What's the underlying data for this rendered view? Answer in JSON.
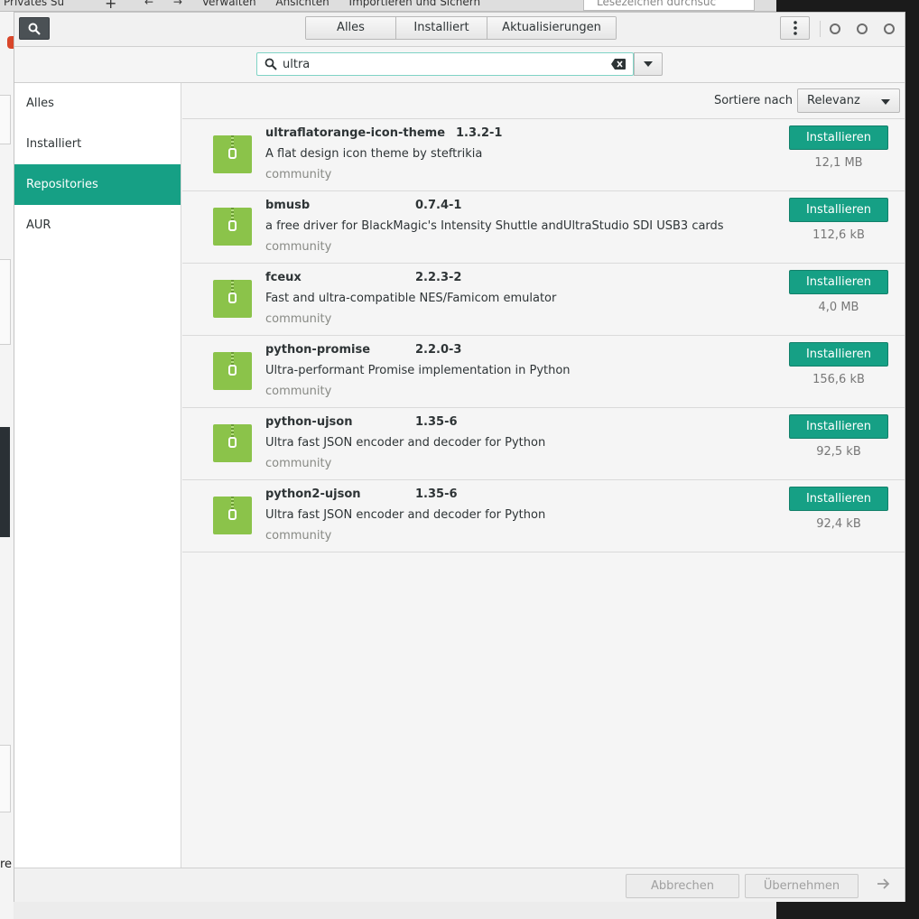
{
  "background": {
    "tab_title": "Privates Su",
    "toolbar": [
      "Verwalten",
      "Ansichten",
      "Importieren und Sichern"
    ],
    "search_placeholder": "Lesezeichen durchsuc",
    "fragment_text": "re"
  },
  "header": {
    "view_tabs": [
      "Alles",
      "Installiert",
      "Aktualisierungen"
    ]
  },
  "search": {
    "query": "ultra"
  },
  "sidebar": {
    "items": [
      {
        "label": "Alles"
      },
      {
        "label": "Installiert"
      },
      {
        "label": "Repositories"
      },
      {
        "label": "AUR"
      }
    ]
  },
  "sort": {
    "label": "Sortiere nach",
    "value": "Relevanz"
  },
  "packages": [
    {
      "name": "ultraflatorange-icon-theme",
      "version": "1.3.2-1",
      "description": "A flat design icon theme by steftrikia",
      "repo": "community",
      "size": "12,1  MB",
      "action": "Installieren"
    },
    {
      "name": "bmusb",
      "version": "0.7.4-1",
      "description": "a free driver for BlackMagic's Intensity Shuttle andUltraStudio SDI USB3 cards",
      "repo": "community",
      "size": "112,6  kB",
      "action": "Installieren"
    },
    {
      "name": "fceux",
      "version": "2.2.3-2",
      "description": "Fast and ultra-compatible NES/Famicom emulator",
      "repo": "community",
      "size": "4,0  MB",
      "action": "Installieren"
    },
    {
      "name": "python-promise",
      "version": "2.2.0-3",
      "description": "Ultra-performant Promise implementation in Python",
      "repo": "community",
      "size": "156,6  kB",
      "action": "Installieren"
    },
    {
      "name": "python-ujson",
      "version": "1.35-6",
      "description": "Ultra fast JSON encoder and decoder for Python",
      "repo": "community",
      "size": "92,5  kB",
      "action": "Installieren"
    },
    {
      "name": "python2-ujson",
      "version": "1.35-6",
      "description": "Ultra fast JSON encoder and decoder for Python",
      "repo": "community",
      "size": "92,4  kB",
      "action": "Installieren"
    }
  ],
  "footer": {
    "cancel_label": "Abbrechen",
    "apply_label": "Übernehmen"
  },
  "colors": {
    "accent": "#16a085",
    "package_icon": "#8bc34a"
  }
}
